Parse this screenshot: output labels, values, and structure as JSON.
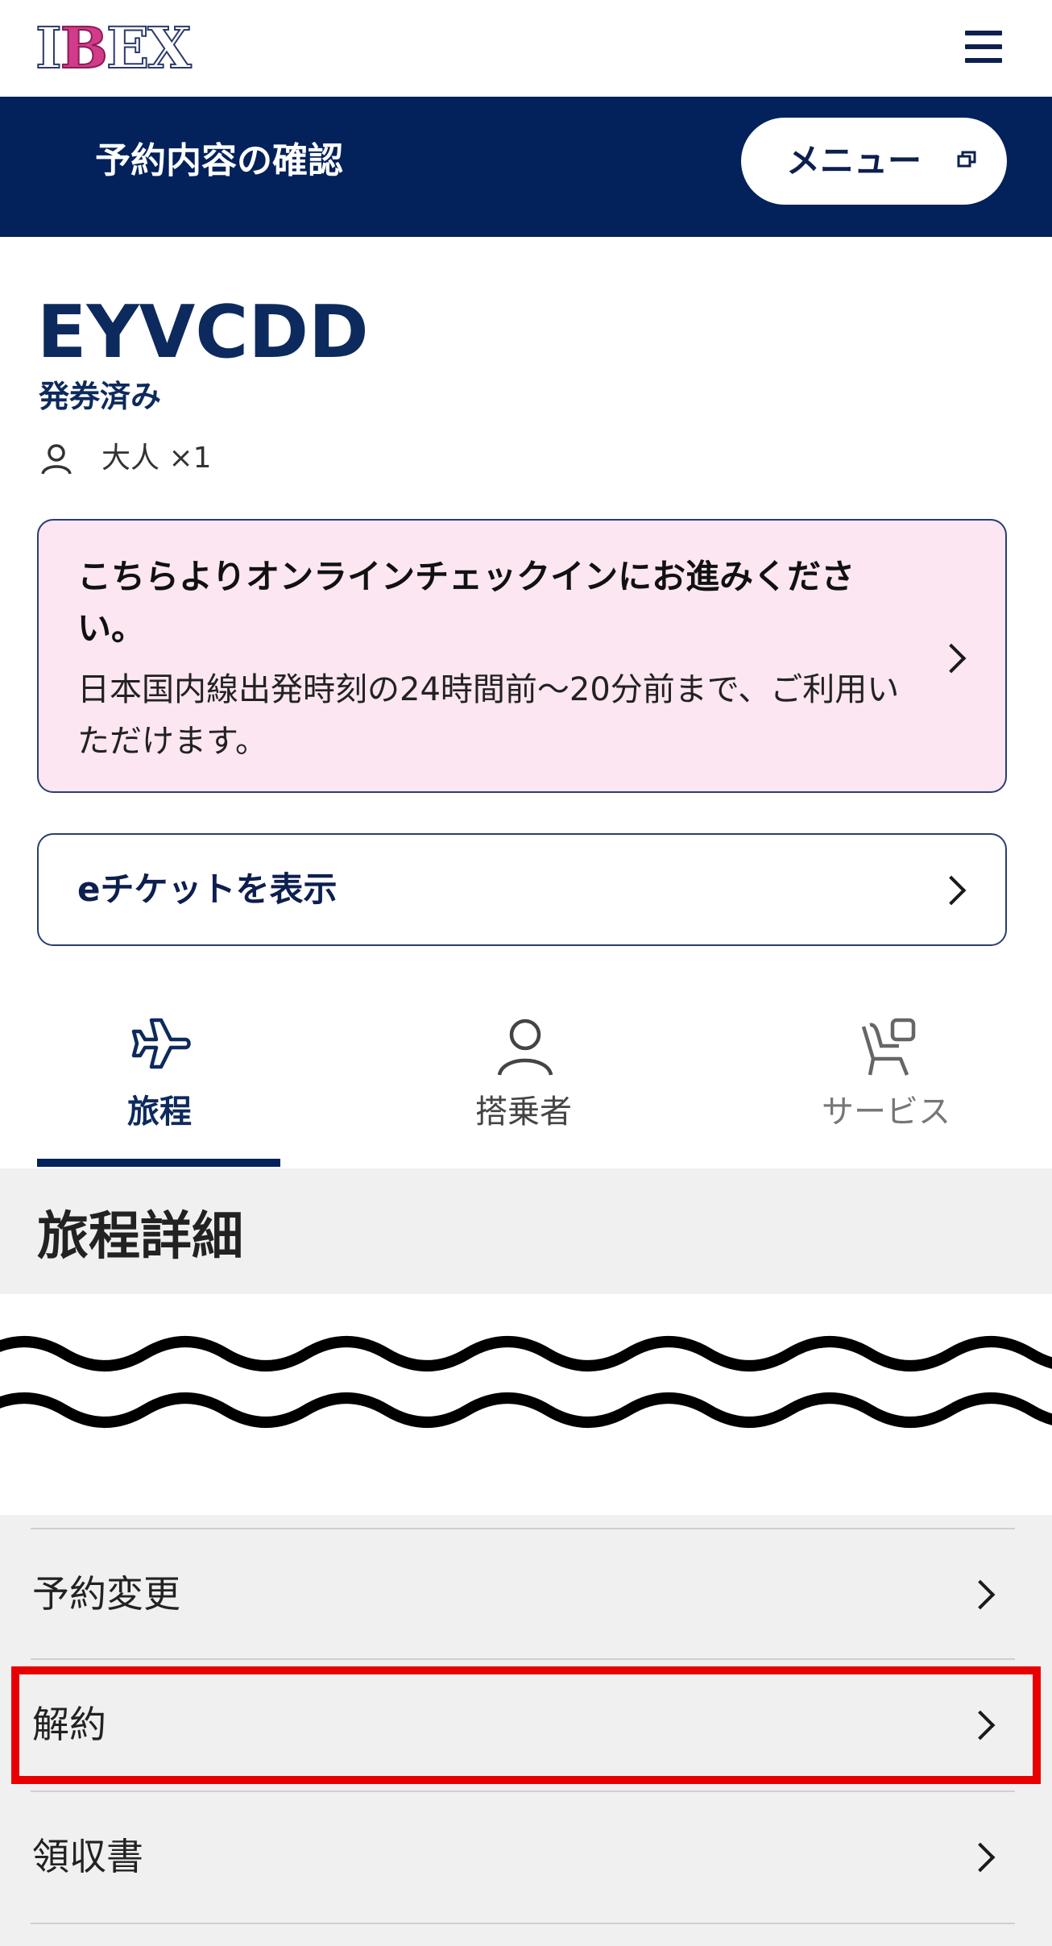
{
  "header": {
    "logo_text": "IBEX",
    "logo_lead": "I",
    "logo_accent": "B",
    "logo_rest": "EX",
    "menu_icon": "hamburger-icon"
  },
  "nav": {
    "title": "予約内容の確認",
    "menu_button": "メニュー",
    "menu_button_icon": "external-window-icon",
    "background": "#03215a"
  },
  "booking": {
    "code": "EYVCDD",
    "status": "発券済み",
    "passenger_icon": "person-icon",
    "passengers": "大人 ×1"
  },
  "checkin_banner": {
    "heading": "こちらよりオンラインチェックインにお進みください。",
    "description": "日本国内線出発時刻の24時間前～20分前まで、ご利用いただけます。",
    "background": "#fbe6f1"
  },
  "eticket": {
    "label": "eチケットを表示"
  },
  "tabs": [
    {
      "label": "旅程",
      "icon": "airplane-icon",
      "active": true
    },
    {
      "label": "搭乗者",
      "icon": "person-icon",
      "active": false
    },
    {
      "label": "サービス",
      "icon": "seat-icon",
      "active": false
    }
  ],
  "section": {
    "title": "旅程詳細"
  },
  "actions": [
    {
      "label": "予約変更"
    },
    {
      "label": "解約",
      "highlighted": true
    },
    {
      "label": "領収書"
    }
  ],
  "highlight_color": "#e80000"
}
